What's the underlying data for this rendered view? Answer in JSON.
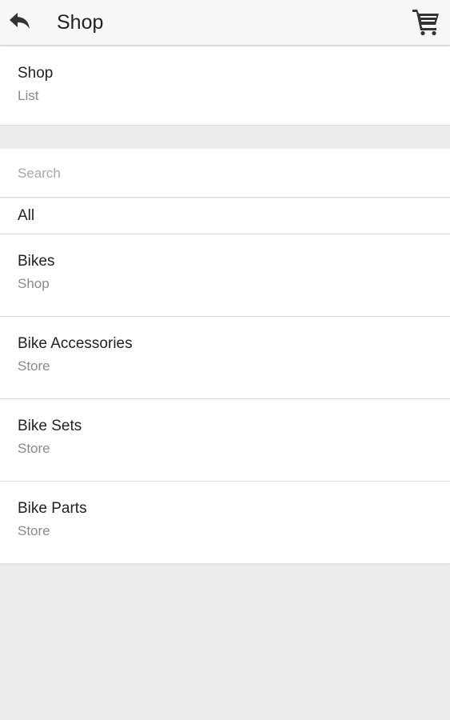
{
  "topbar": {
    "back_icon": "reply-arrow-icon",
    "title": "Shop",
    "cart_icon": "shopping-cart-icon"
  },
  "header": {
    "title": "Shop",
    "subtitle": "List"
  },
  "search": {
    "placeholder": "Search",
    "value": ""
  },
  "list": {
    "all_label": "All",
    "items": [
      {
        "name": "Bikes",
        "sub": "Shop"
      },
      {
        "name": "Bike Accessories",
        "sub": "Store"
      },
      {
        "name": "Bike Sets",
        "sub": "Store"
      },
      {
        "name": "Bike Parts",
        "sub": "Store"
      }
    ]
  },
  "colors": {
    "background": "#ececec",
    "card": "#ffffff",
    "topbar": "#f7f7f7",
    "text_primary": "#222222",
    "text_secondary": "#8a8a8a",
    "divider": "#dedede"
  }
}
